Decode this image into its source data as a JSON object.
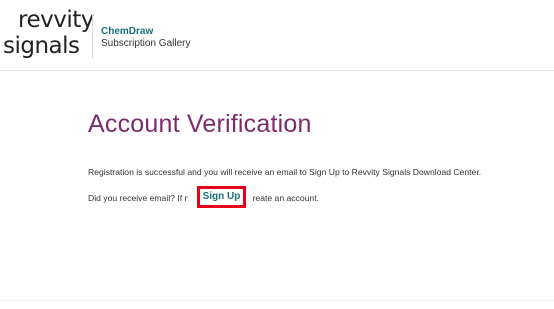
{
  "header": {
    "logo_line1": "revvity",
    "logo_line2": "signals",
    "product_name": "ChemDraw",
    "product_sub": "Subscription Gallery"
  },
  "main": {
    "title": "Account Verification",
    "message": "Registration is successful and you will receive an email to Sign Up to Revvity Signals Download Center.",
    "prompt_before": "Did you receive email? If n",
    "link_label": "Sign Up",
    "prompt_after": "create an account."
  },
  "colors": {
    "title": "#7b2b6e",
    "link": "#1a6f7a",
    "highlight_box": "#e8001a"
  }
}
